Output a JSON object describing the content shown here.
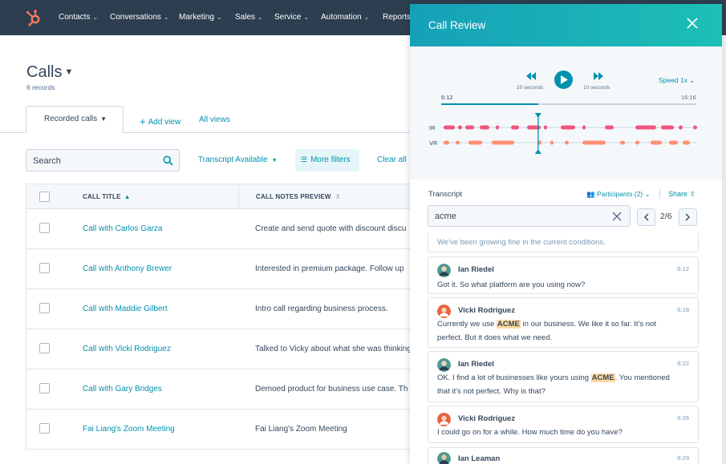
{
  "nav": {
    "items": [
      "Contacts",
      "Conversations",
      "Marketing",
      "Sales",
      "Service",
      "Automation",
      "Reports"
    ]
  },
  "page": {
    "title": "Calls",
    "subtitle": "6 records"
  },
  "tabs": {
    "active": "Recorded calls",
    "add_view": "Add view",
    "all_views": "All views"
  },
  "filters": {
    "search_placeholder": "Search",
    "transcript": "Transcript Available",
    "more": "More filters",
    "clear": "Clear all"
  },
  "table": {
    "headers": [
      "CALL TITLE",
      "CALL NOTES PREVIEW"
    ],
    "rows": [
      {
        "title": "Call with Carlos Garza",
        "notes": "Create and send quote with discount discu"
      },
      {
        "title": "Call with Anthony Brewer",
        "notes": "Interested in premium package. Follow up"
      },
      {
        "title": "Call with Maddie Gilbert",
        "notes": "Intro call regarding business process."
      },
      {
        "title": "Call with Vicki Rodriguez",
        "notes": "Talked to Vicky about what she was thinking"
      },
      {
        "title": "Call with Gary Bridges",
        "notes": "Demoed product for business use case. Th"
      },
      {
        "title": "Fai Liang's Zoom Meeting",
        "notes": "Fai Liang's Zoom Meeting"
      }
    ]
  },
  "panel": {
    "title": "Call Review",
    "player": {
      "back_label": "10 seconds",
      "fwd_label": "10 seconds",
      "speed": "Speed 1x",
      "current": "6:12",
      "total": "16:16",
      "progress": 0.38,
      "speakers": [
        "IR",
        "VR"
      ]
    },
    "transcript": {
      "label": "Transcript",
      "participants": "Participants (2)",
      "share": "Share",
      "search_value": "acme",
      "pager": "2/6",
      "partial": "We've been growing fine in the current conditions.",
      "messages": [
        {
          "name": "Ian Riedel",
          "time": "6:12",
          "pre": "Got it. So what platform are you using now?",
          "hl": "",
          "post": ""
        },
        {
          "name": "Vicki Rodriguez",
          "time": "6:18",
          "pre": "Currently we use ",
          "hl": "ACME",
          "post": " in our business. We like it so far. It's not perfect. But it does what we need."
        },
        {
          "name": "Ian Riedel",
          "time": "6:22",
          "pre": "OK. I find a lot of businesses like yours using ",
          "hl": "ACME",
          "post": ". You mentioned that it's not perfect. Why is that?"
        },
        {
          "name": "Vicki Rodriguez",
          "time": "6:26",
          "pre": "I could go on for a while. How much time do you have?",
          "hl": "",
          "post": ""
        },
        {
          "name": "Ian Leaman",
          "time": "6:29",
          "pre": "",
          "hl": "",
          "post": ""
        }
      ]
    }
  },
  "colors": {
    "nav_bg": "#2d3e50",
    "link": "#0091ae",
    "header_gradient": [
      "#16a0b8",
      "#1dbfb6"
    ],
    "ir_wave": "#f2547d",
    "vr_wave": "#ff8f73",
    "highlight": "#ffd9a1"
  }
}
